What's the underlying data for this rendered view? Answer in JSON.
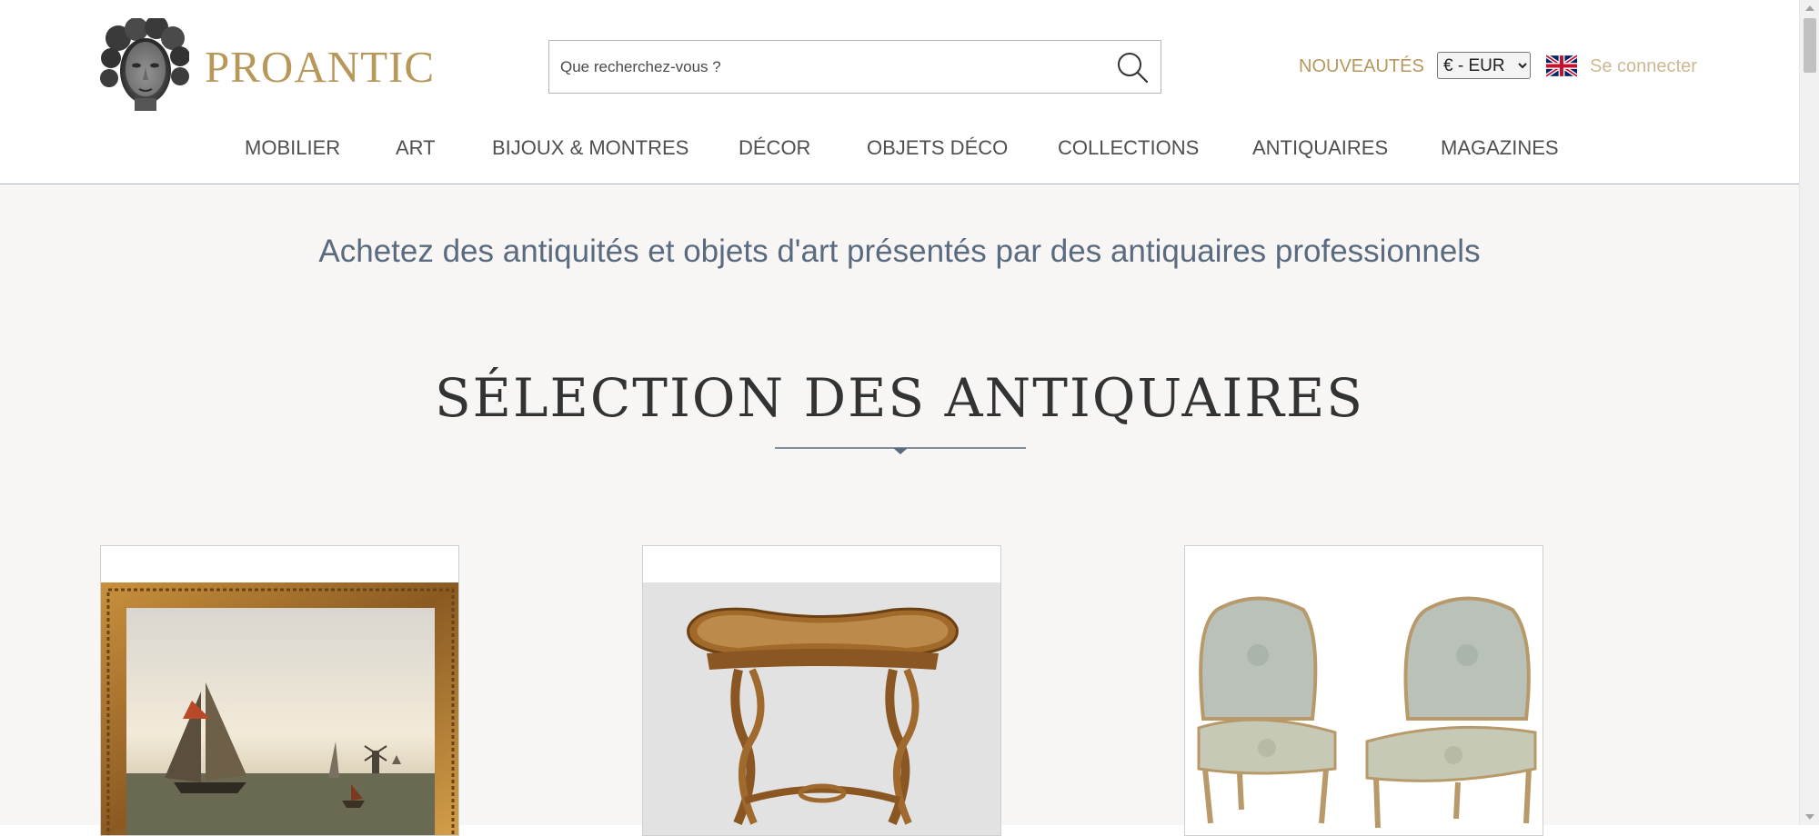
{
  "brand": {
    "name": "PROANTIC",
    "logo_icon": "greek-head-bust-icon",
    "accent_color": "#b8975b"
  },
  "search": {
    "placeholder": "Que recherchez-vous ?",
    "value": "",
    "icon": "search-icon"
  },
  "header": {
    "new_label": "NOUVEAUTÉS",
    "currency_selected": "€ - EUR",
    "language_icon": "uk-flag-icon",
    "login_label": "Se connecter"
  },
  "nav": {
    "items": [
      {
        "label": "MOBILIER"
      },
      {
        "label": "ART"
      },
      {
        "label": "BIJOUX & MONTRES"
      },
      {
        "label": "DÉCOR"
      },
      {
        "label": "OBJETS DÉCO"
      },
      {
        "label": "COLLECTIONS"
      },
      {
        "label": "ANTIQUAIRES"
      },
      {
        "label": "MAGAZINES"
      }
    ]
  },
  "main": {
    "tagline": "Achetez des antiquités et objets d'art présentés par des antiquaires professionnels",
    "section_title": "SÉLECTION DES ANTIQUAIRES",
    "cards": [
      {
        "subject": "marine-painting-gilt-frame"
      },
      {
        "subject": "marquetry-kidney-side-table"
      },
      {
        "subject": "pair-louis-xv-chairs"
      }
    ]
  },
  "colors": {
    "accent_gold": "#b8975b",
    "login_gold": "#cfb891",
    "tagline_blue": "#5a6b80",
    "page_background": "#f7f6f4"
  }
}
